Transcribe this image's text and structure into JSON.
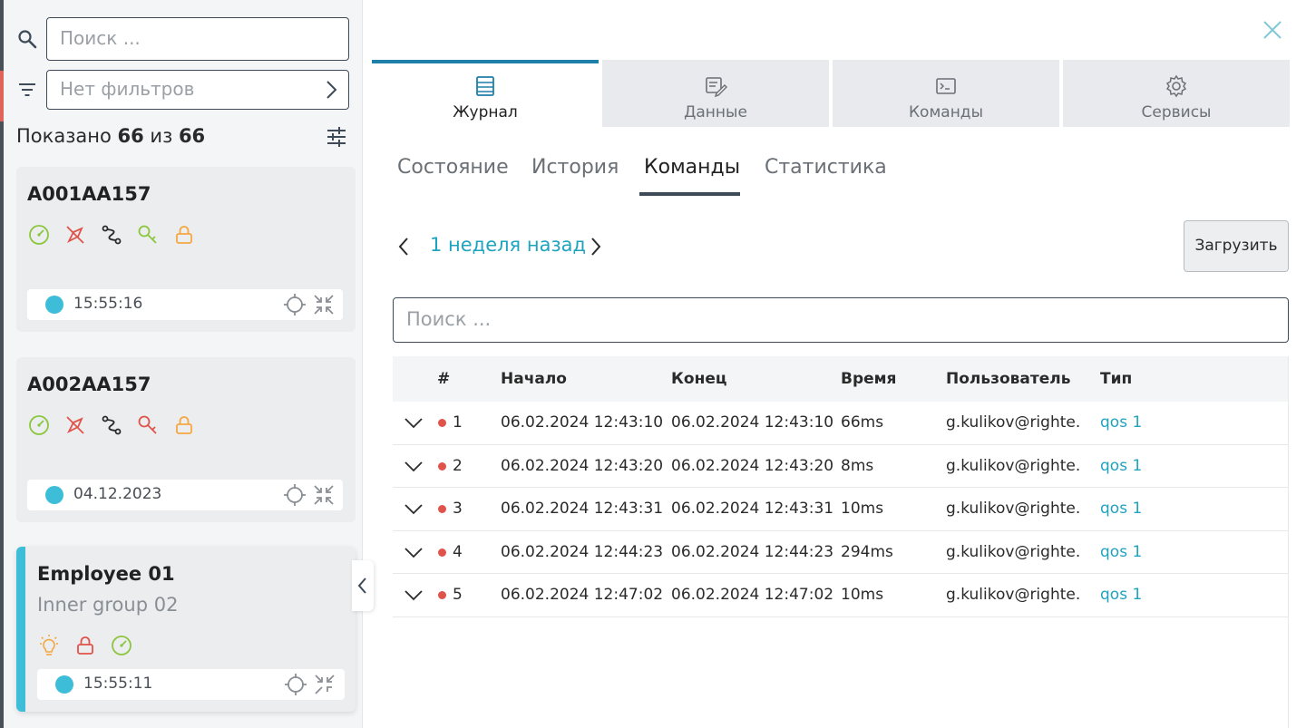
{
  "sidebar": {
    "search_placeholder": "Поиск ...",
    "filter_placeholder": "Нет фильтров",
    "shown_prefix": "Показано",
    "shown_count": "66",
    "shown_of": "из",
    "shown_total": "66",
    "units": [
      {
        "title": "A001AA157",
        "status_time": "15:55:16",
        "icons": [
          "speedometer-icon",
          "no-gps-icon",
          "route-icon",
          "key-icon",
          "lock-icon"
        ]
      },
      {
        "title": "A002AA157",
        "status_time": "04.12.2023",
        "icons": [
          "speedometer-icon",
          "no-gps-icon",
          "route-icon",
          "key-icon",
          "lock-icon"
        ]
      },
      {
        "title": "Employee 01",
        "subtitle": "Inner group 02",
        "status_time": "15:55:11",
        "icons": [
          "bulb-icon",
          "lock-icon",
          "speedometer-icon"
        ]
      }
    ]
  },
  "main": {
    "top_tabs": [
      {
        "label": "Журнал",
        "icon": "journal-icon",
        "active": true
      },
      {
        "label": "Данные",
        "icon": "data-icon",
        "active": false
      },
      {
        "label": "Команды",
        "icon": "terminal-icon",
        "active": false
      },
      {
        "label": "Сервисы",
        "icon": "gear-icon",
        "active": false
      }
    ],
    "sub_tabs": [
      "Состояние",
      "История",
      "Команды",
      "Статистика"
    ],
    "active_sub_tab": "Команды",
    "period_label": "1 неделя назад",
    "load_button": "Загрузить",
    "table_search_placeholder": "Поиск ...",
    "table": {
      "columns": [
        "#",
        "Начало",
        "Конец",
        "Время",
        "Пользователь",
        "Тип"
      ],
      "rows": [
        {
          "n": "1",
          "start": "06.02.2024 12:43:10",
          "end": "06.02.2024 12:43:10",
          "time": "66ms",
          "user": "g.kulikov@righte...",
          "type": "qos 1"
        },
        {
          "n": "2",
          "start": "06.02.2024 12:43:20",
          "end": "06.02.2024 12:43:20",
          "time": "8ms",
          "user": "g.kulikov@righte...",
          "type": "qos 1"
        },
        {
          "n": "3",
          "start": "06.02.2024 12:43:31",
          "end": "06.02.2024 12:43:31",
          "time": "10ms",
          "user": "g.kulikov@righte...",
          "type": "qos 1"
        },
        {
          "n": "4",
          "start": "06.02.2024 12:44:23",
          "end": "06.02.2024 12:44:23",
          "time": "294ms",
          "user": "g.kulikov@righte...",
          "type": "qos 1"
        },
        {
          "n": "5",
          "start": "06.02.2024 12:47:02",
          "end": "06.02.2024 12:47:02",
          "time": "10ms",
          "user": "g.kulikov@righte...",
          "type": "qos 1"
        }
      ]
    }
  },
  "colors": {
    "accent": "#1fa3bf",
    "status_dot": "#3ebdd8",
    "row_dot": "#e0534a",
    "active_tab_border": "#1e7fa8"
  }
}
